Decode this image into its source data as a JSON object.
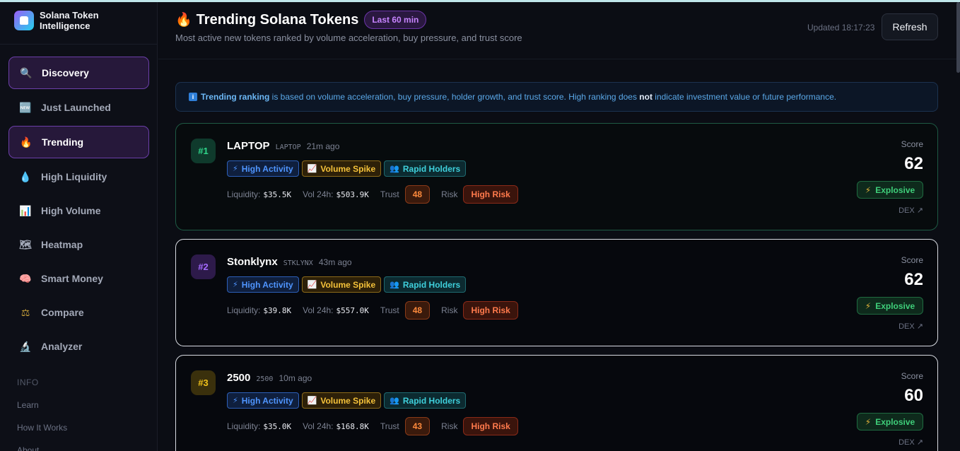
{
  "brand": {
    "name": "Solana Token Intelligence"
  },
  "sidebar": {
    "items": [
      {
        "label": "Discovery",
        "icon": "🔍"
      },
      {
        "label": "Just Launched",
        "icon": "🆕"
      },
      {
        "label": "Trending",
        "icon": "🔥"
      },
      {
        "label": "High Liquidity",
        "icon": "💧"
      },
      {
        "label": "High Volume",
        "icon": "📊"
      },
      {
        "label": "Heatmap",
        "icon": "🗺"
      },
      {
        "label": "Smart Money",
        "icon": "🧠"
      },
      {
        "label": "Compare",
        "icon": "⚖"
      },
      {
        "label": "Analyzer",
        "icon": "🔬"
      }
    ],
    "info_header": "INFO",
    "info_links": [
      "Learn",
      "How It Works",
      "About"
    ]
  },
  "header": {
    "icon": "🔥",
    "title": "Trending Solana Tokens",
    "badge": "Last 60 min",
    "subtitle": "Most active new tokens ranked by volume acceleration, buy pressure, and trust score",
    "updated": "Updated 18:17:23",
    "refresh_label": "Refresh"
  },
  "banner": {
    "icon": "i",
    "lead": "Trending ranking",
    "text1": " is based on volume acceleration, buy pressure, holder growth, and trust score. High ranking does ",
    "emph": "not",
    "text2": " indicate investment value or future performance."
  },
  "labels": {
    "liquidity": "Liquidity:",
    "vol": "Vol 24h:",
    "trust": "Trust",
    "risk": "Risk",
    "score": "Score",
    "dex": "DEX ↗"
  },
  "tags": {
    "activity": {
      "icon": "⚡",
      "label": "High Activity"
    },
    "spike": {
      "icon": "📈",
      "label": "Volume Spike"
    },
    "holders": {
      "icon": "👥",
      "label": "Rapid Holders"
    }
  },
  "tokens": [
    {
      "rank": "#1",
      "name": "LAPTOP",
      "symbol": "LAPTOP",
      "age": "21m ago",
      "liquidity": "$35.5K",
      "volume": "$503.9K",
      "trust": "48",
      "risk": "High Risk",
      "score": "62",
      "momentum_icon": "⚡",
      "momentum": "Explosive"
    },
    {
      "rank": "#2",
      "name": "Stonklynx",
      "symbol": "STKLYNX",
      "age": "43m ago",
      "liquidity": "$39.8K",
      "volume": "$557.0K",
      "trust": "48",
      "risk": "High Risk",
      "score": "62",
      "momentum_icon": "⚡",
      "momentum": "Explosive"
    },
    {
      "rank": "#3",
      "name": "2500",
      "symbol": "2500",
      "age": "10m ago",
      "liquidity": "$35.0K",
      "volume": "$168.8K",
      "trust": "43",
      "risk": "High Risk",
      "score": "60",
      "momentum_icon": "⚡",
      "momentum": "Explosive"
    }
  ],
  "colors": {
    "accent_purple": "#6b3fa8",
    "rank1": "#2fd58a",
    "rank2": "#a56bff",
    "rank3": "#f1c21b",
    "risk": "#ff7a4c",
    "explosive": "#3fcf7a"
  }
}
